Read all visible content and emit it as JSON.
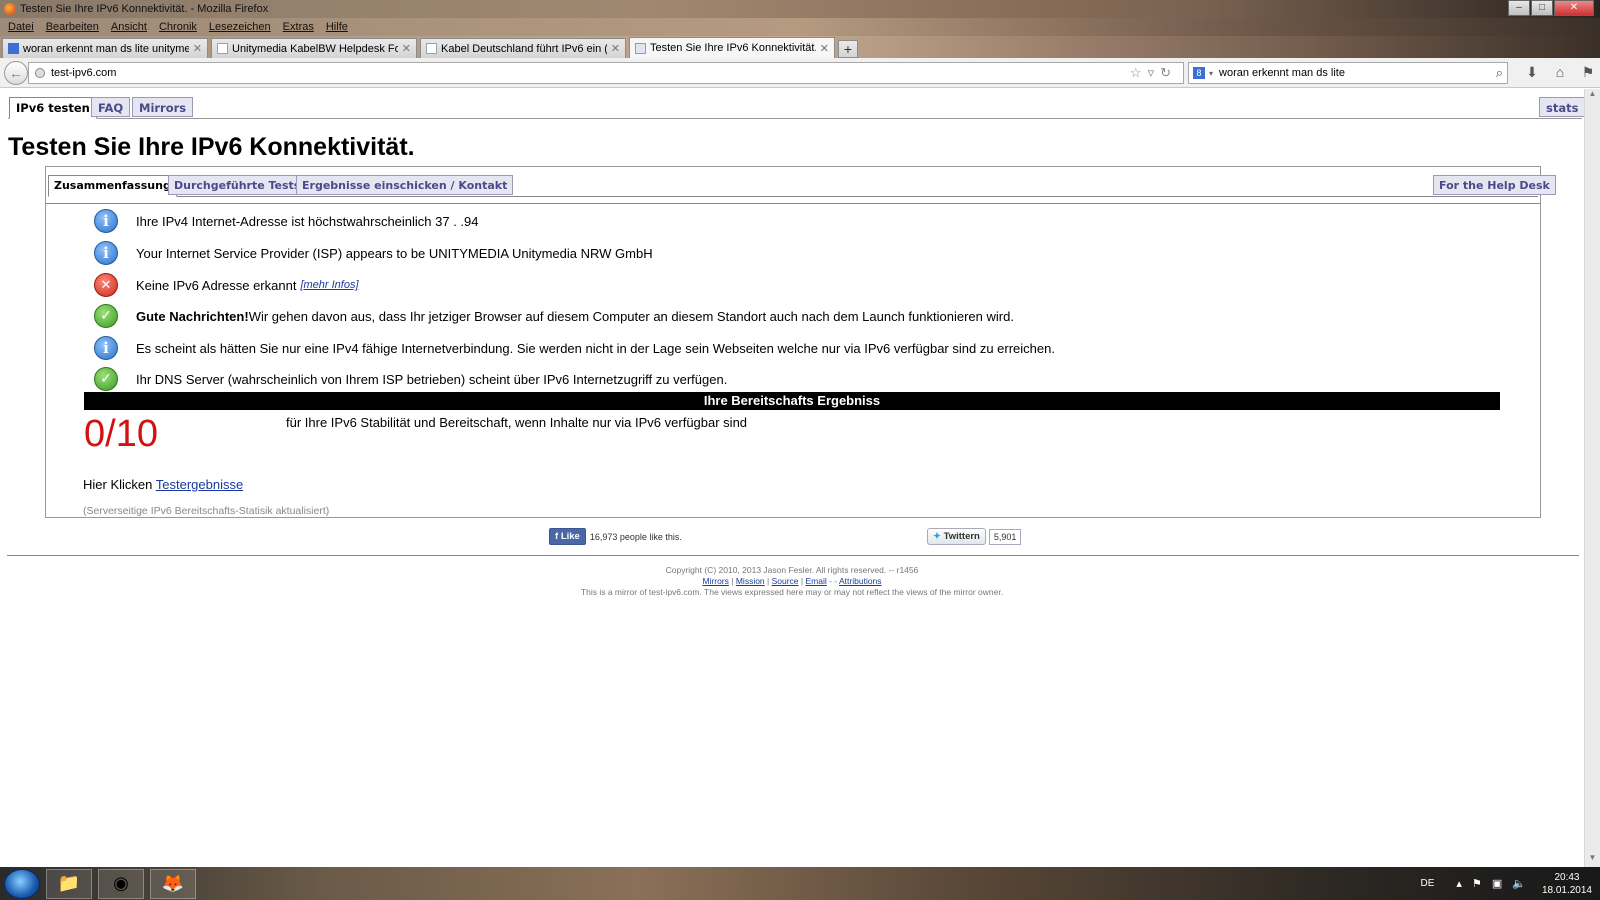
{
  "window": {
    "title": "Testen Sie Ihre IPv6 Konnektivität. - Mozilla Firefox"
  },
  "menu": [
    "Datei",
    "Bearbeiten",
    "Ansicht",
    "Chronik",
    "Lesezeichen",
    "Extras",
    "Hilfe"
  ],
  "tabs": [
    {
      "label": "woran erkennt man ds lite unitymedi..."
    },
    {
      "label": "Unitymedia KabelBW Helpdesk Foru..."
    },
    {
      "label": "Kabel Deutschland führt IPv6 ein (DS-..."
    },
    {
      "label": "Testen Sie Ihre IPv6 Konnektivität."
    }
  ],
  "nav": {
    "url": "test-ipv6.com",
    "search": "woran erkennt man ds lite"
  },
  "site_tabs": {
    "test": "IPv6 testen",
    "faq": "FAQ",
    "mirrors": "Mirrors",
    "stats": "stats"
  },
  "page_title": "Testen Sie Ihre IPv6 Konnektivität.",
  "inner_tabs": {
    "summary": "Zusammenfassung",
    "tests": "Durchgeführte Tests",
    "submit": "Ergebnisse einschicken / Kontakt",
    "helpdesk": "For the Help Desk"
  },
  "results": {
    "ipv4": "Ihre IPv4 Internet-Adresse ist höchstwahrscheinlich 37 . .94",
    "isp": "Your Internet Service Provider (ISP) appears to be UNITYMEDIA Unitymedia NRW GmbH",
    "noipv6": "Keine IPv6 Adresse erkannt",
    "noipv6_link": "[mehr Infos]",
    "good_bold": "Gute Nachrichten!",
    "good_text": "Wir gehen davon aus, dass Ihr jetziger Browser auf diesem Computer an diesem Standort auch nach dem Launch funktionieren wird.",
    "ipv4only": "Es scheint als hätten Sie nur eine IPv4 fähige Internetverbindung. Sie werden nicht in der Lage sein Webseiten welche nur via IPv6 verfügbar sind zu erreichen.",
    "dns": "Ihr DNS Server (wahrscheinlich von Ihrem ISP betrieben) scheint über IPv6 Internetzugriff zu verfügen."
  },
  "readiness": {
    "header": "Ihre Bereitschafts Ergebniss",
    "score": "0/10",
    "desc": "für Ihre IPv6 Stabilität und Bereitschaft, wenn Inhalte nur via IPv6 verfügbar sind",
    "click_prefix": "Hier Klicken",
    "click_link": "Testergebnisse",
    "stat_note": "(Serverseitige IPv6 Bereitschafts-Statisik aktualisiert)"
  },
  "social": {
    "fb_label": "Like",
    "fb_count": "16,973 people like this.",
    "tw_label": "Twittern",
    "tw_count": "5,901"
  },
  "footer": {
    "copyright": "Copyright (C) 2010, 2013 Jason Fesler. All rights reserved. -- r1456",
    "links": [
      "Mirrors",
      "Mission",
      "Source",
      "Email",
      "Attributions"
    ],
    "mirror_note": "This is a mirror of test-ipv6.com. The views expressed here may or may not reflect the views of the mirror owner."
  },
  "taskbar": {
    "lang": "DE",
    "time": "20:43",
    "date": "18.01.2014"
  },
  "colors": {
    "score": "#d41010",
    "link": "#1a3aa0",
    "tab_text": "#4a4a8a"
  }
}
